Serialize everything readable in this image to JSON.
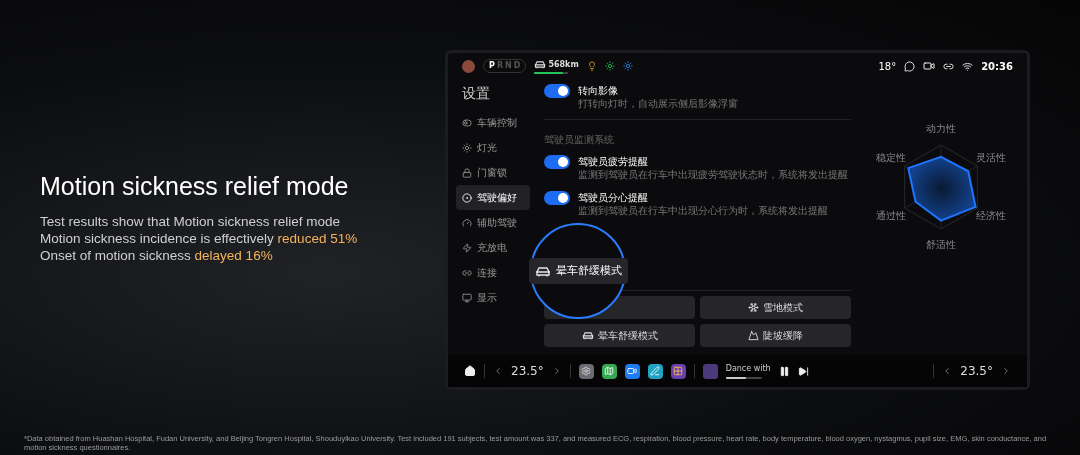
{
  "headline": {
    "title": "Motion sickness relief mode",
    "lines": [
      "Test results show that Motion sickness relief mode",
      "Motion sickness incidence is effectively **reduced 51%**",
      "Onset of motion sickness **delayed 16%**"
    ]
  },
  "screen": {
    "status_bar": {
      "gears": [
        {
          "label": "P",
          "selected": true
        },
        {
          "label": "R",
          "selected": false
        },
        {
          "label": "N",
          "selected": false
        },
        {
          "label": "D",
          "selected": false
        }
      ],
      "range": {
        "text": "568km",
        "level": 0.85
      },
      "temperature": "18°",
      "clock": "20:36"
    },
    "sidebar": {
      "title": "设置",
      "items": [
        {
          "label": "车辆控制",
          "selected": false
        },
        {
          "label": "灯光",
          "selected": false
        },
        {
          "label": "门窗锁",
          "selected": false
        },
        {
          "label": "驾驶偏好",
          "selected": true
        },
        {
          "label": "辅助驾驶",
          "selected": false
        },
        {
          "label": "充放电",
          "selected": false
        },
        {
          "label": "连接",
          "selected": false
        },
        {
          "label": "显示",
          "selected": false
        }
      ]
    },
    "settings": [
      {
        "kind": "toggle",
        "title": "转向影像",
        "subtitle": "打转向灯时，自动展示侧后影像浮窗",
        "on": true
      },
      {
        "kind": "section",
        "title": "驾驶员监测系统"
      },
      {
        "kind": "toggle",
        "title": "驾驶员疲劳提醒",
        "subtitle": "监测到驾驶员在行车中出现疲劳驾驶状态时，系统将发出提醒",
        "on": true
      },
      {
        "kind": "toggle",
        "title": "驾驶员分心提醒",
        "subtitle": "监测到驾驶员在行车中出现分心行为时，系统将发出提醒",
        "on": true
      }
    ],
    "modes": [
      {
        "kind": "snow",
        "label": "雪地模式"
      },
      {
        "kind": "comfort",
        "label": "晕车舒缓模式"
      },
      {
        "kind": "descent",
        "label": "陡坡缓降"
      }
    ],
    "magnifier": {
      "label": "晕车舒缓模式"
    },
    "radar": {
      "labels": [
        "动力性",
        "灵活性",
        "经济性",
        "舒适性",
        "通过性",
        "稳定性"
      ]
    },
    "dock": {
      "left_temperature": "23.5°",
      "media": {
        "title": "Dance with",
        "level": 0.55
      },
      "right_temperature": "23.5°"
    }
  },
  "footnote": "*Data obtained from Huashan Hospital, Fudan University, and Beijing Tongren Hospital, Shouduyikao University. Test included 191 subjects, test amount was 337, and measured ECG, respiration, blood pressure, heart rate, body temperature, blood oxygen, nystagmus, pupil size, EMG, skin conductance, and motion sickness questionnaires."
}
